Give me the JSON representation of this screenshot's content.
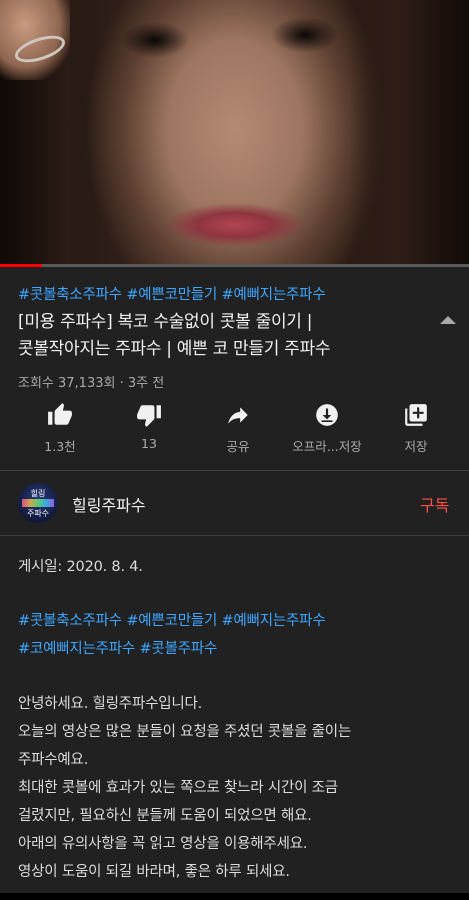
{
  "video": {
    "progress_fraction": 0.09
  },
  "info": {
    "hashtags": "#콧볼축소주파수 #예쁜코만들기 #예뻐지는주파수",
    "title_line1": "[미용 주파수] 복코 수술없이 콧볼 줄이기 |",
    "title_line2": "콧볼작아지는 주파수 | 예쁜 코 만들기 주파수",
    "meta": "조회수 37,133회 · 3주 전"
  },
  "actions": [
    {
      "label": "1.3천",
      "icon": "thumb-up-icon"
    },
    {
      "label": "13",
      "icon": "thumb-down-icon"
    },
    {
      "label": "공유",
      "icon": "share-icon"
    },
    {
      "label": "오프라...저장",
      "icon": "download-icon"
    },
    {
      "label": "저장",
      "icon": "add-to-playlist-icon"
    }
  ],
  "channel": {
    "avatar_text_top": "힐링",
    "avatar_text_bottom": "주파수",
    "name": "힐링주파수",
    "subscribe_label": "구독"
  },
  "description": {
    "posted": "게시일: 2020. 8. 4.",
    "tags_line1": "#콧볼축소주파수 #예쁜코만들기 #예뻐지는주파수",
    "tags_line2": "#코예뻐지는주파수 #콧볼주파수",
    "lines": [
      "안녕하세요. 힐링주파수입니다.",
      "오늘의 영상은 많은 분들이 요청을 주셨던 콧볼을 줄이는",
      "주파수예요.",
      "최대한 콧볼에 효과가 있는 쪽으로 찾느라 시간이 조금",
      "걸렸지만, 필요하신 분들께 도움이 되었으면 해요.",
      "아래의 유의사항을 꼭 읽고 영상을 이용해주세요.",
      "영상이 도움이 되길 바라며, 좋은 하루 되세요."
    ]
  },
  "colors": {
    "background": "#212121",
    "link": "#3ea6ff",
    "subscribe": "#ff4e45",
    "progress": "#ff0000"
  }
}
